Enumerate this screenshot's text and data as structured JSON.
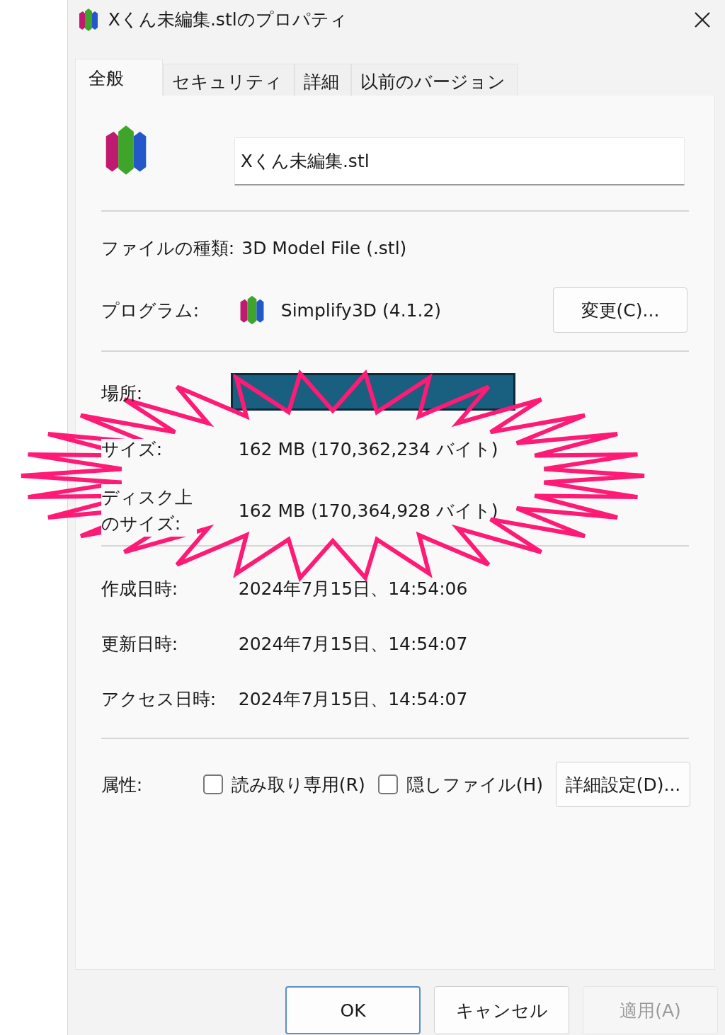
{
  "window": {
    "title": "Xくん未編集.stlのプロパティ"
  },
  "tabs": [
    {
      "label": "全般",
      "selected": true
    },
    {
      "label": "セキュリティ",
      "selected": false
    },
    {
      "label": "詳細",
      "selected": false
    },
    {
      "label": "以前のバージョン",
      "selected": false
    }
  ],
  "name_field": {
    "value": "Xくん未編集.stl"
  },
  "file_type": {
    "label": "ファイルの種類:",
    "value": "3D Model File (.stl)"
  },
  "program": {
    "label": "プログラム:",
    "name": "Simplify3D (4.1.2)",
    "button": "変更(C)..."
  },
  "location": {
    "label": "場所:",
    "redacted": true
  },
  "size": {
    "label": "サイズ:",
    "value": "162 MB (170,362,234 バイト)"
  },
  "size_on_disk": {
    "label": "ディスク上のサイズ:",
    "value": "162 MB (170,364,928 バイト)"
  },
  "dates": [
    {
      "label": "作成日時:",
      "value": "2024年7月15日、14:54:06"
    },
    {
      "label": "更新日時:",
      "value": "2024年7月15日、14:54:07"
    },
    {
      "label": "アクセス日時:",
      "value": "2024年7月15日、14:54:07"
    }
  ],
  "attributes": {
    "label": "属性:",
    "checkboxes": [
      {
        "label": "読み取り専用(R)",
        "checked": false
      },
      {
        "label": "隠しファイル(H)",
        "checked": false
      }
    ],
    "button": "詳細設定(D)..."
  },
  "buttons": [
    {
      "label": "OK",
      "default": true,
      "disabled": false
    },
    {
      "label": "キャンセル",
      "default": false,
      "disabled": false
    },
    {
      "label": "適用(A)",
      "default": false,
      "disabled": true
    }
  ],
  "annotation": {
    "kind": "starburst"
  }
}
